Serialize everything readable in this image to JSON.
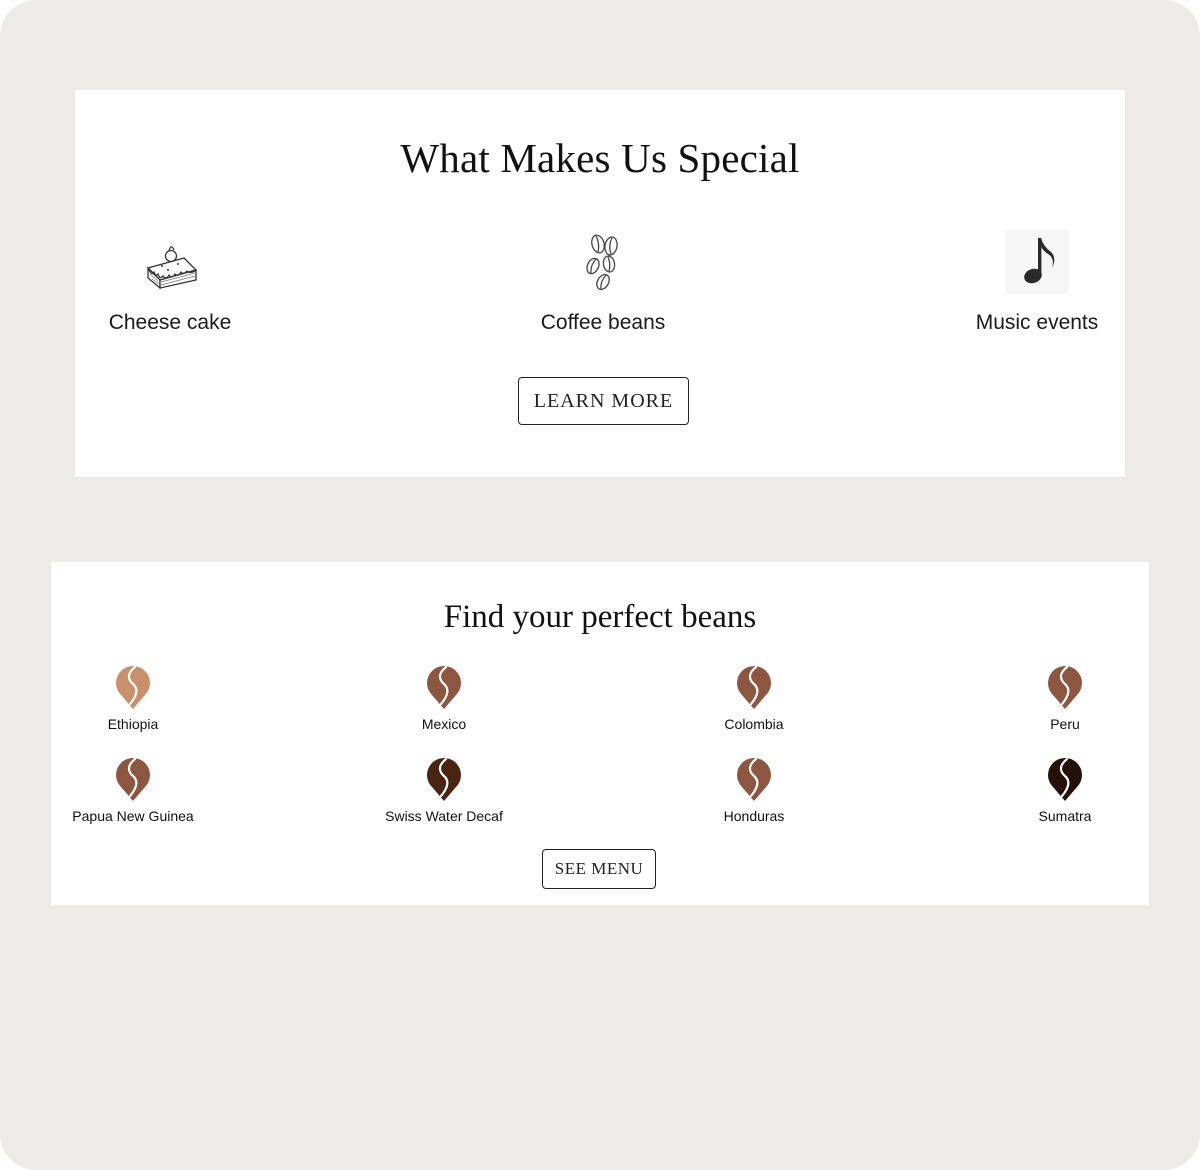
{
  "special": {
    "title": "What Makes Us Special",
    "features": [
      {
        "label": "Cheese cake",
        "icon": "cheesecake-icon"
      },
      {
        "label": "Coffee beans",
        "icon": "coffee-beans-icon"
      },
      {
        "label": "Music events",
        "icon": "music-note-icon"
      }
    ],
    "button_label": "LEARN MORE"
  },
  "beans": {
    "title": "Find your perfect beans",
    "items": [
      {
        "label": "Ethiopia",
        "color": "#c8906b"
      },
      {
        "label": "Mexico",
        "color": "#8c5641"
      },
      {
        "label": "Colombia",
        "color": "#8c5641"
      },
      {
        "label": "Peru",
        "color": "#8c5641"
      },
      {
        "label": "Papua New Guinea",
        "color": "#8c5641"
      },
      {
        "label": "Swiss Water Decaf",
        "color": "#4a2413"
      },
      {
        "label": "Honduras",
        "color": "#8c5641"
      },
      {
        "label": "Sumatra",
        "color": "#24110a"
      }
    ],
    "button_label": "SEE MENU"
  }
}
